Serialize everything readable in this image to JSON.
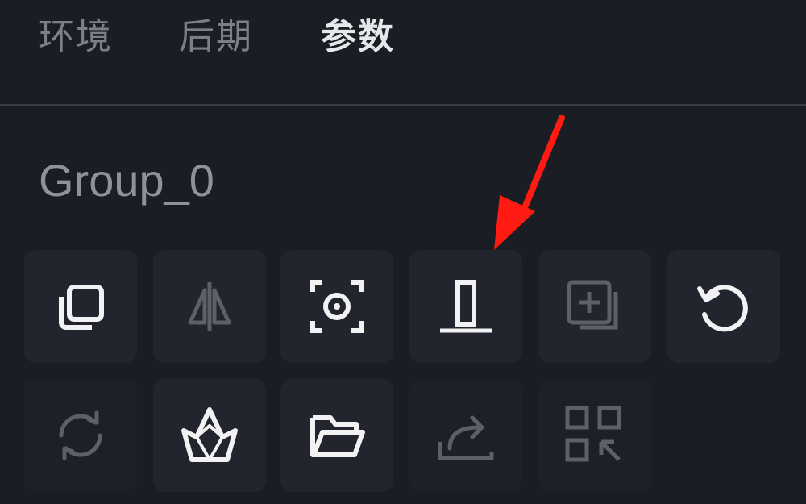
{
  "tabs": [
    {
      "label": "环境",
      "active": false
    },
    {
      "label": "后期",
      "active": false
    },
    {
      "label": "参数",
      "active": true
    }
  ],
  "group": {
    "title": "Group_0"
  },
  "toolbar": {
    "row1": [
      "layers-icon",
      "mirror-icon",
      "focus-target-icon",
      "align-bottom-icon",
      "add-layer-icon",
      "undo-icon"
    ],
    "row2": [
      "sync-icon",
      "crystal-icon",
      "folder-icon",
      "export-icon",
      "qr-grid-icon"
    ]
  },
  "colors": {
    "background": "#1b1d24",
    "tile": "#22252d",
    "icon_bright": "#f2f2f4",
    "icon_dim": "#5d6069",
    "arrow": "#ff1a12"
  }
}
